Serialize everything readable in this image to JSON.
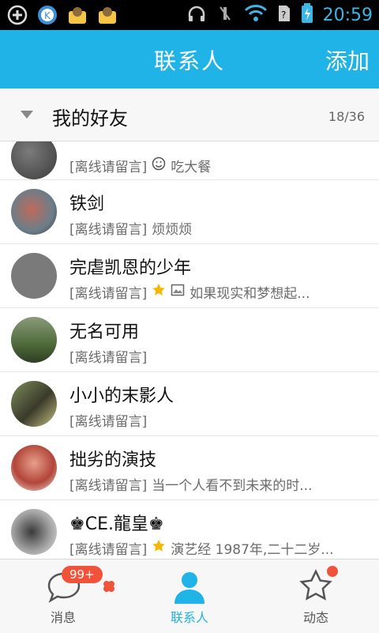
{
  "status_bar": {
    "time": "20:59",
    "icons": [
      "plus-icon",
      "k-app-icon",
      "app-icon",
      "app-icon",
      "headphone-icon",
      "mute-icon",
      "wifi-icon",
      "sim-icon",
      "battery-icon"
    ]
  },
  "appbar": {
    "title": "联系人",
    "action": "添加"
  },
  "group": {
    "name": "我的好友",
    "count": "18/36"
  },
  "contacts": [
    {
      "name": "铁剑",
      "status": "[离线请留言]",
      "signature": "烦烦烦",
      "icons": []
    },
    {
      "name": "完虐凯恩的少年",
      "status": "[离线请留言]",
      "signature": "如果现实和梦想起...",
      "icons": [
        "star-icon",
        "image-icon"
      ]
    },
    {
      "name": "无名可用",
      "status": "[离线请留言]",
      "signature": "",
      "icons": []
    },
    {
      "name": "小小的末影人",
      "status": "[离线请留言]",
      "signature": "",
      "icons": []
    },
    {
      "name": "拙劣的演技",
      "status": "[离线请留言]",
      "signature": "当一个人看不到未来的时...",
      "icons": []
    },
    {
      "name": "♚CE.龍皇♚",
      "status": "[离线请留言]",
      "signature": "演艺经 1987年,二十二岁...",
      "icons": [
        "star-icon"
      ]
    }
  ],
  "partial_contact": {
    "status": "[离线请留言]",
    "signature": "吃大餐"
  },
  "tabs": [
    {
      "label": "消息",
      "badge": "99+"
    },
    {
      "label": "联系人"
    },
    {
      "label": "动态"
    }
  ],
  "colors": {
    "accent": "#20b3e7",
    "badge": "#f0523a"
  }
}
